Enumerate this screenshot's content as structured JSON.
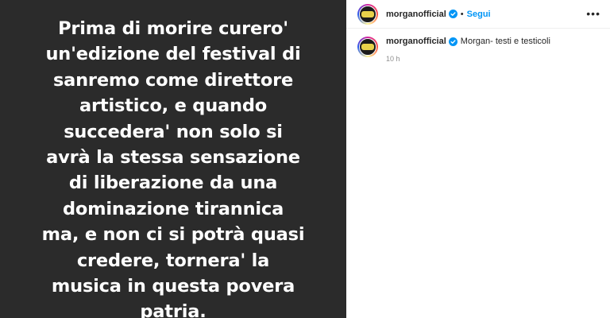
{
  "post": {
    "text": "Prima di morire curero'\nun'edizione del festival di\nsanremo come direttore\nartistico, e quando\nsuccedera' non solo si\navrà la stessa sensazione\ndi liberazione da una\ndominazione tirannica\nma, e non ci si potrà quasi\ncredere, tornera' la\nmusica in questa povera\npatria."
  },
  "header": {
    "username": "morganofficial",
    "separator": "•",
    "follow_label": "Segui",
    "more_label": "•••"
  },
  "comment": {
    "username": "morganofficial",
    "caption": "Morgan- testi e testicoli",
    "time": "10 h"
  },
  "colors": {
    "verified": "#0095f6",
    "follow": "#0095f6",
    "image_background": "#2b2b2b"
  }
}
